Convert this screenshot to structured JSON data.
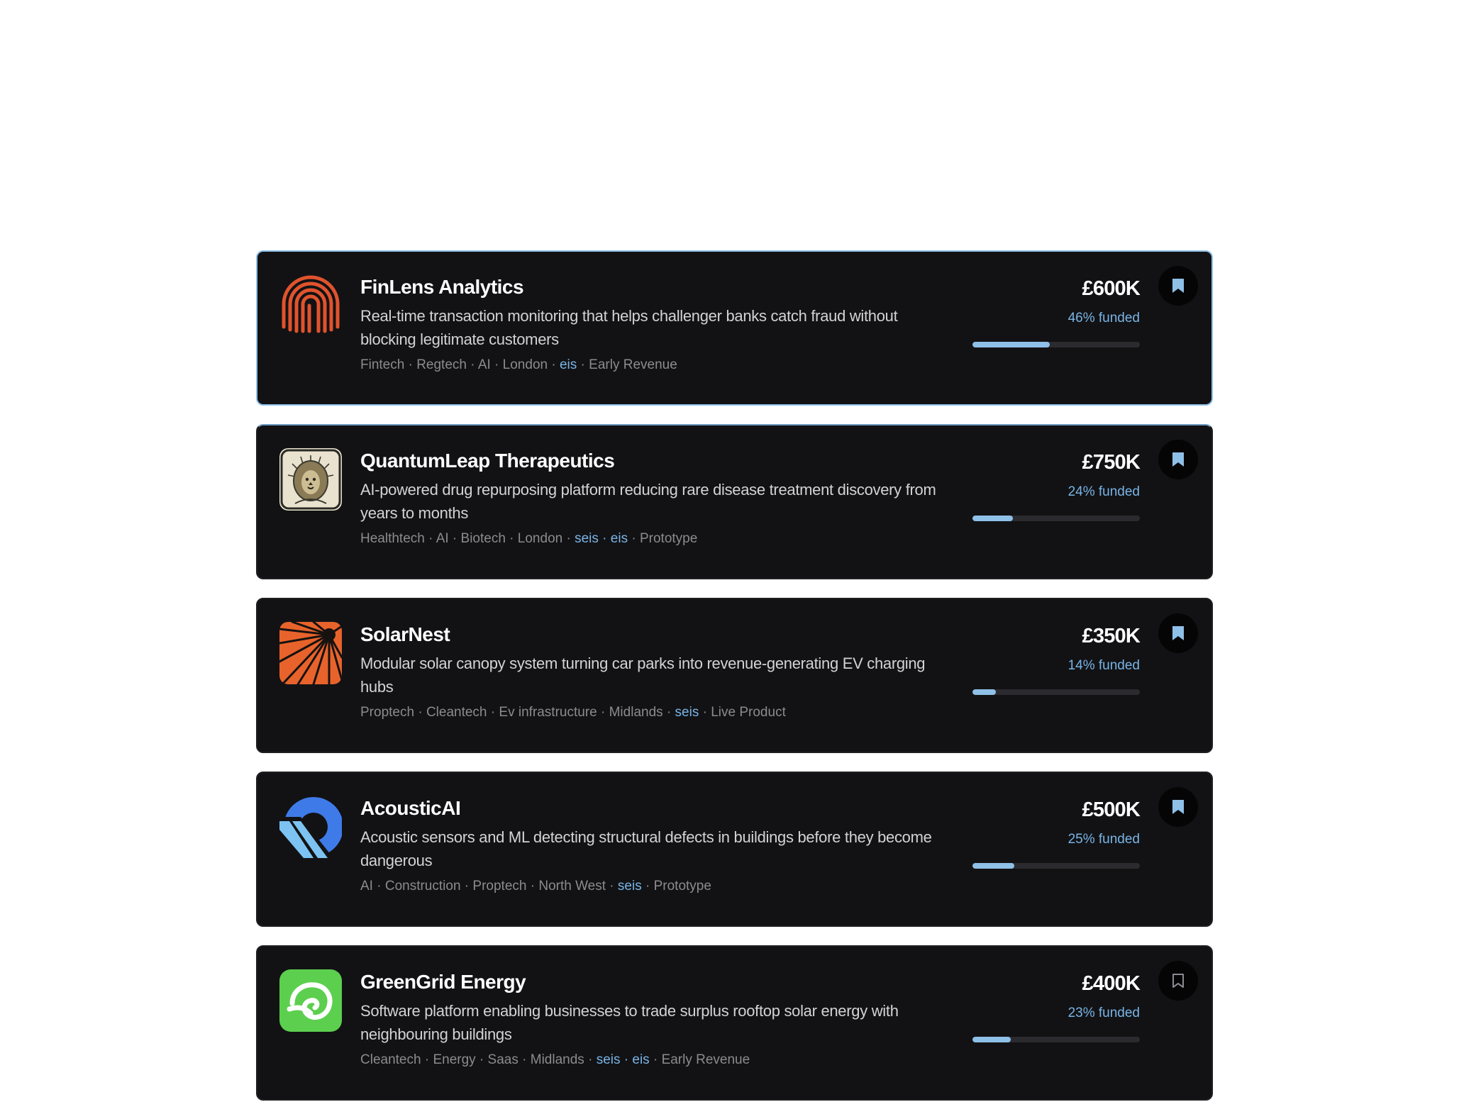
{
  "colors": {
    "card_bg": "#121214",
    "accent": "#8fc0e8",
    "tax_badge": "#79b4e6"
  },
  "companies": [
    {
      "name": "FinLens Analytics",
      "description": "Real-time transaction monitoring that helps challenger banks catch fraud without blocking legitimate customers",
      "tags": [
        "Fintech",
        "Regtech",
        "AI",
        "London"
      ],
      "tax": [
        "eis"
      ],
      "stage": "Early Revenue",
      "amount": "£600K",
      "funded_text": "46% funded",
      "funded_pct": 46,
      "bookmarked": true,
      "logo_icon": "fingerprint-icon"
    },
    {
      "name": "QuantumLeap Therapeutics",
      "description": "AI-powered drug repurposing platform reducing rare disease treatment discovery from years to months",
      "tags": [
        "Healthtech",
        "AI",
        "Biotech",
        "London"
      ],
      "tax": [
        "seis",
        "eis"
      ],
      "stage": "Prototype",
      "amount": "£750K",
      "funded_text": "24% funded",
      "funded_pct": 24,
      "bookmarked": true,
      "logo_icon": "lion-icon"
    },
    {
      "name": "SolarNest",
      "description": "Modular solar canopy system turning car parks into revenue-generating EV charging hubs",
      "tags": [
        "Proptech",
        "Cleantech",
        "Ev infrastructure",
        "Midlands"
      ],
      "tax": [
        "seis"
      ],
      "stage": "Live Product",
      "amount": "£350K",
      "funded_text": "14% funded",
      "funded_pct": 14,
      "bookmarked": true,
      "logo_icon": "sunburst-icon"
    },
    {
      "name": "AcousticAI",
      "description": "Acoustic sensors and ML detecting structural defects in buildings before they become dangerous",
      "tags": [
        "AI",
        "Construction",
        "Proptech",
        "North West"
      ],
      "tax": [
        "seis"
      ],
      "stage": "Prototype",
      "amount": "£500K",
      "funded_text": "25% funded",
      "funded_pct": 25,
      "bookmarked": true,
      "logo_icon": "sound-ring-icon"
    },
    {
      "name": "GreenGrid Energy",
      "description": "Software platform enabling businesses to trade surplus rooftop solar energy with neighbouring buildings",
      "tags": [
        "Cleantech",
        "Energy",
        "Saas",
        "Midlands"
      ],
      "tax": [
        "seis",
        "eis"
      ],
      "stage": "Early Revenue",
      "amount": "£400K",
      "funded_text": "23% funded",
      "funded_pct": 23,
      "bookmarked": false,
      "logo_icon": "leaf-swirl-icon"
    }
  ]
}
